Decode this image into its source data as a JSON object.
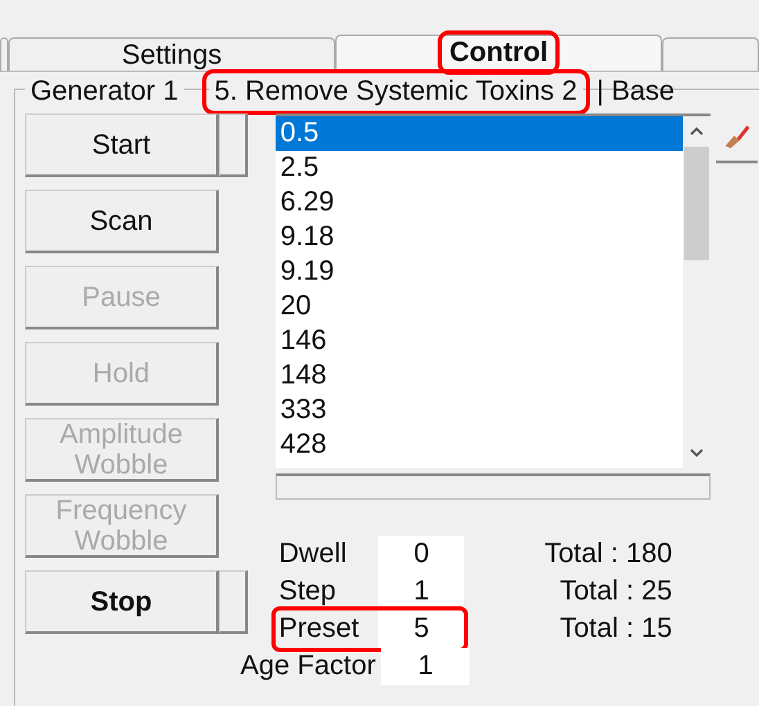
{
  "tabs": [
    {
      "label": "Settings",
      "selected": false,
      "highlighted": false
    },
    {
      "label": "Control",
      "selected": true,
      "highlighted": true
    }
  ],
  "generator": {
    "title": "Generator 1",
    "program": "5. Remove Systemic Toxins 2",
    "program_highlighted": true,
    "base": "| Base"
  },
  "buttons": [
    {
      "label": "Start",
      "disabled": false,
      "bold": false,
      "side": true
    },
    {
      "label": "Scan",
      "disabled": false,
      "bold": false,
      "side": false
    },
    {
      "label": "Pause",
      "disabled": true,
      "bold": false,
      "side": false
    },
    {
      "label": "Hold",
      "disabled": true,
      "bold": false,
      "side": false
    },
    {
      "label": "Amplitude Wobble",
      "disabled": true,
      "bold": false,
      "side": false
    },
    {
      "label": "Frequency Wobble",
      "disabled": true,
      "bold": false,
      "side": false
    },
    {
      "label": "Stop",
      "disabled": false,
      "bold": true,
      "side": true
    }
  ],
  "frequencies": [
    {
      "value": "0.5",
      "selected": true
    },
    {
      "value": "2.5",
      "selected": false
    },
    {
      "value": "6.29",
      "selected": false
    },
    {
      "value": "9.18",
      "selected": false
    },
    {
      "value": "9.19",
      "selected": false
    },
    {
      "value": "20",
      "selected": false
    },
    {
      "value": "146",
      "selected": false
    },
    {
      "value": "148",
      "selected": false
    },
    {
      "value": "333",
      "selected": false
    },
    {
      "value": "428",
      "selected": false
    }
  ],
  "fields": [
    {
      "label": "Dwell",
      "value": "0",
      "total": "Total : 180",
      "highlighted": false
    },
    {
      "label": "Step",
      "value": "1",
      "total": "Total : 25",
      "highlighted": false
    },
    {
      "label": "Preset",
      "value": "5",
      "total": "Total : 15",
      "highlighted": true
    }
  ],
  "age_factor": {
    "label": "Age Factor",
    "value": "1"
  }
}
